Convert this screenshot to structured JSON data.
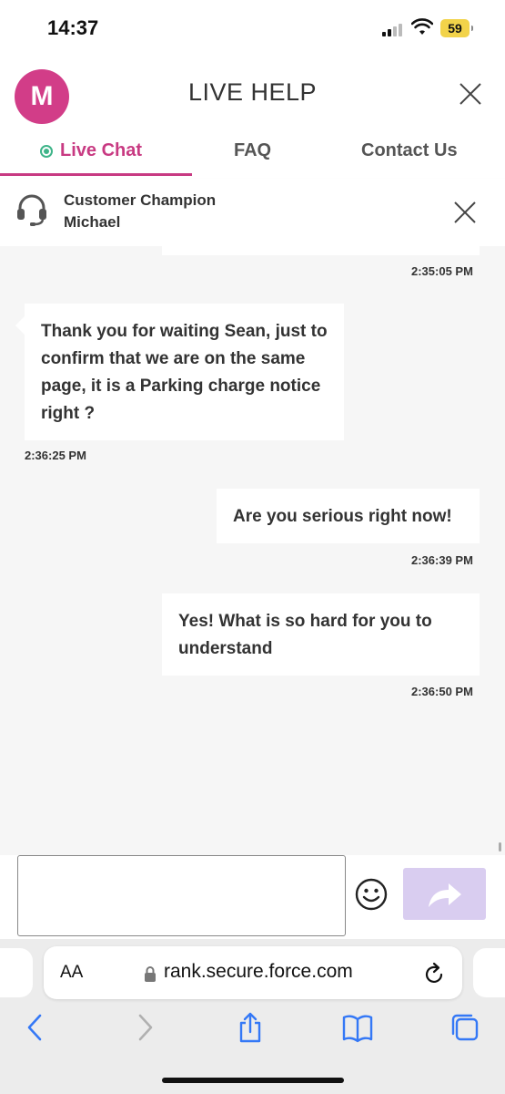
{
  "status_bar": {
    "time": "14:37",
    "battery": "59"
  },
  "header": {
    "avatar_letter": "M",
    "title": "LIVE HELP"
  },
  "tabs": [
    {
      "label": "Live Chat",
      "active": true
    },
    {
      "label": "FAQ",
      "active": false
    },
    {
      "label": "Contact Us",
      "active": false
    }
  ],
  "agent": {
    "role": "Customer Champion",
    "name": "Michael"
  },
  "messages": [
    {
      "sender": "user",
      "text": "",
      "time": "2:35:05 PM"
    },
    {
      "sender": "agent",
      "text": "Thank you for waiting Sean, just to confirm that we are on the same page, it is a Parking charge notice right ?",
      "time": "2:36:25 PM"
    },
    {
      "sender": "user",
      "text": "Are you serious right now!",
      "time": "2:36:39 PM"
    },
    {
      "sender": "user",
      "text": "Yes! What is so hard for you to understand",
      "time": "2:36:50 PM"
    }
  ],
  "composer": {
    "value": "",
    "placeholder": ""
  },
  "browser": {
    "text_size_label": "AA",
    "url": "rank.secure.force.com"
  },
  "colors": {
    "brand": "#d23d88",
    "accent": "#c83a82",
    "online": "#3eb489",
    "send_disabled": "#d9cdf0",
    "ios_blue": "#3478f6"
  }
}
